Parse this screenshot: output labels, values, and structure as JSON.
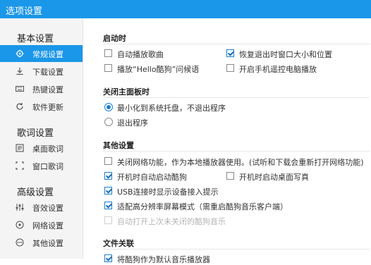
{
  "window": {
    "title": "选项设置"
  },
  "sidebar": {
    "sections": [
      {
        "label": "基本设置",
        "items": [
          {
            "label": "常规设置",
            "icon": "gear-icon",
            "active": true
          },
          {
            "label": "下载设置",
            "icon": "download-icon"
          },
          {
            "label": "热键设置",
            "icon": "keyboard-icon"
          },
          {
            "label": "软件更新",
            "icon": "refresh-icon"
          }
        ]
      },
      {
        "label": "歌词设置",
        "items": [
          {
            "label": "桌面歌词",
            "icon": "desktop-lyrics-icon"
          },
          {
            "label": "窗口歌词",
            "icon": "window-lyrics-icon"
          }
        ]
      },
      {
        "label": "高级设置",
        "items": [
          {
            "label": "音效设置",
            "icon": "equalizer-icon"
          },
          {
            "label": "网络设置",
            "icon": "network-icon"
          },
          {
            "label": "其他设置",
            "icon": "more-icon"
          }
        ]
      }
    ]
  },
  "content": {
    "startup": {
      "title": "启动时",
      "options": [
        {
          "label": "自动播放歌曲",
          "checked": false
        },
        {
          "label": "恢复退出时窗口大小和位置",
          "checked": true
        },
        {
          "label": "播放“Hello酷狗”问候语",
          "checked": false
        },
        {
          "label": "开启手机遥控电脑播放",
          "checked": false
        }
      ]
    },
    "close_panel": {
      "title": "关闭主面板时",
      "options": [
        {
          "label": "最小化到系统托盘，不退出程序",
          "selected": true
        },
        {
          "label": "退出程序",
          "selected": false
        }
      ]
    },
    "other": {
      "title": "其他设置",
      "options": [
        {
          "label": "关闭网络功能，作为本地播放器使用。(试听和下载会重新打开网络功能)",
          "checked": false
        },
        {
          "label": "开机时自动启动酷狗",
          "checked": true
        },
        {
          "label": "开机时启动桌面写真",
          "checked": false
        },
        {
          "label": "USB连接时显示设备接入提示",
          "checked": true
        },
        {
          "label": "适配高分辨率屏幕模式（需重启酷狗音乐客户端）",
          "checked": true
        },
        {
          "label": "自动打开上次未关闭的酷狗音乐",
          "checked": false,
          "disabled": true
        }
      ]
    },
    "file_assoc": {
      "title": "文件关联",
      "options": [
        {
          "label": "将酷狗作为默认音乐播放器",
          "checked": true
        }
      ]
    }
  },
  "colors": {
    "accent": "#1a97e8",
    "sidebar_bg": "#f4f4f4"
  }
}
